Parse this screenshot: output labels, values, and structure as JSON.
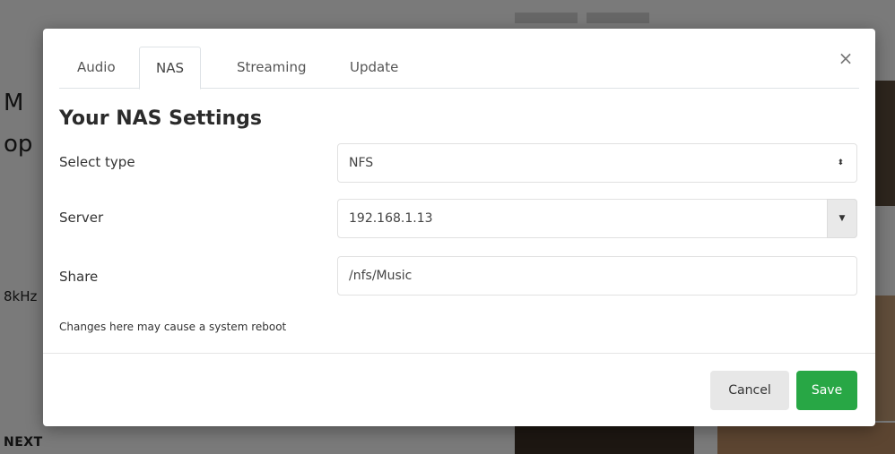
{
  "background": {
    "title_line1": "M",
    "title_line2": "op",
    "rate_fragment": "8kHz",
    "next_label": "NEXT"
  },
  "tabs": [
    {
      "label": "Audio",
      "active": false
    },
    {
      "label": "NAS",
      "active": true
    },
    {
      "label": "Streaming",
      "active": false
    },
    {
      "label": "Update",
      "active": false
    }
  ],
  "modal": {
    "close_glyph": "×",
    "title": "Your NAS Settings",
    "fields": {
      "type": {
        "label": "Select type",
        "value": "NFS",
        "arrows": "⬍"
      },
      "server": {
        "label": "Server",
        "value": "192.168.1.13",
        "dropdown": "▼"
      },
      "share": {
        "label": "Share",
        "value": "/nfs/Music"
      }
    },
    "hint": "Changes here may cause a system reboot",
    "cancel_label": "Cancel",
    "save_label": "Save"
  },
  "colors": {
    "save_button": "#28a745",
    "cancel_button": "#e7e7e7"
  },
  "icons": {
    "close": "close-icon",
    "select_arrows": "select-arrows-icon",
    "dropdown": "chevron-down-icon"
  }
}
